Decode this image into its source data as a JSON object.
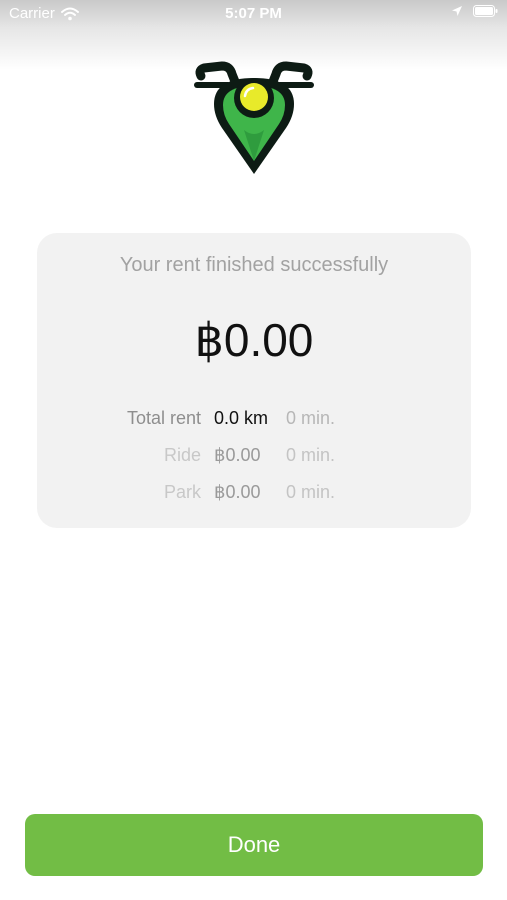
{
  "status_bar": {
    "carrier": "Carrier",
    "time": "5:07 PM"
  },
  "logo": {
    "icon": "scooter-location-pin-logo",
    "colors": {
      "outline": "#0d1b14",
      "fill": "#3fb54a",
      "light": "#e8ea2a"
    }
  },
  "card": {
    "title": "Your rent finished successfully",
    "amount": "฿0.00",
    "rows": [
      {
        "label": "Total rent",
        "value1": "0.0 km",
        "value2": "0 min."
      },
      {
        "label": "Ride",
        "value1": "฿0.00",
        "value2": "0 min."
      },
      {
        "label": "Park",
        "value1": "฿0.00",
        "value2": "0 min."
      }
    ]
  },
  "done_button": {
    "label": "Done",
    "color": "#72bd45"
  }
}
